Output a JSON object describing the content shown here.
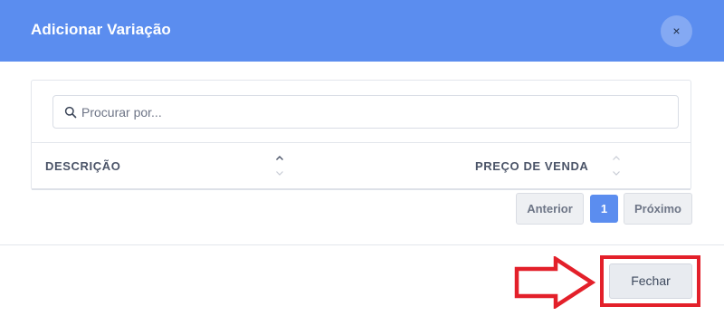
{
  "modal": {
    "title": "Adicionar Variação",
    "close_symbol": "×"
  },
  "search": {
    "placeholder": "Procurar por...",
    "value": "",
    "icon": "search-icon"
  },
  "table": {
    "columns": [
      {
        "label": "DESCRIÇÃO",
        "sort": "ascending"
      },
      {
        "label": "PREÇO DE VENDA",
        "sort": "none"
      }
    ],
    "rows": []
  },
  "pagination": {
    "previous_label": "Anterior",
    "current_page": "1",
    "next_label": "Próximo"
  },
  "footer": {
    "close_label": "Fechar"
  },
  "colors": {
    "header_bg": "#5b8def",
    "accent": "#5b8def",
    "annotation_red": "#e3202a"
  }
}
